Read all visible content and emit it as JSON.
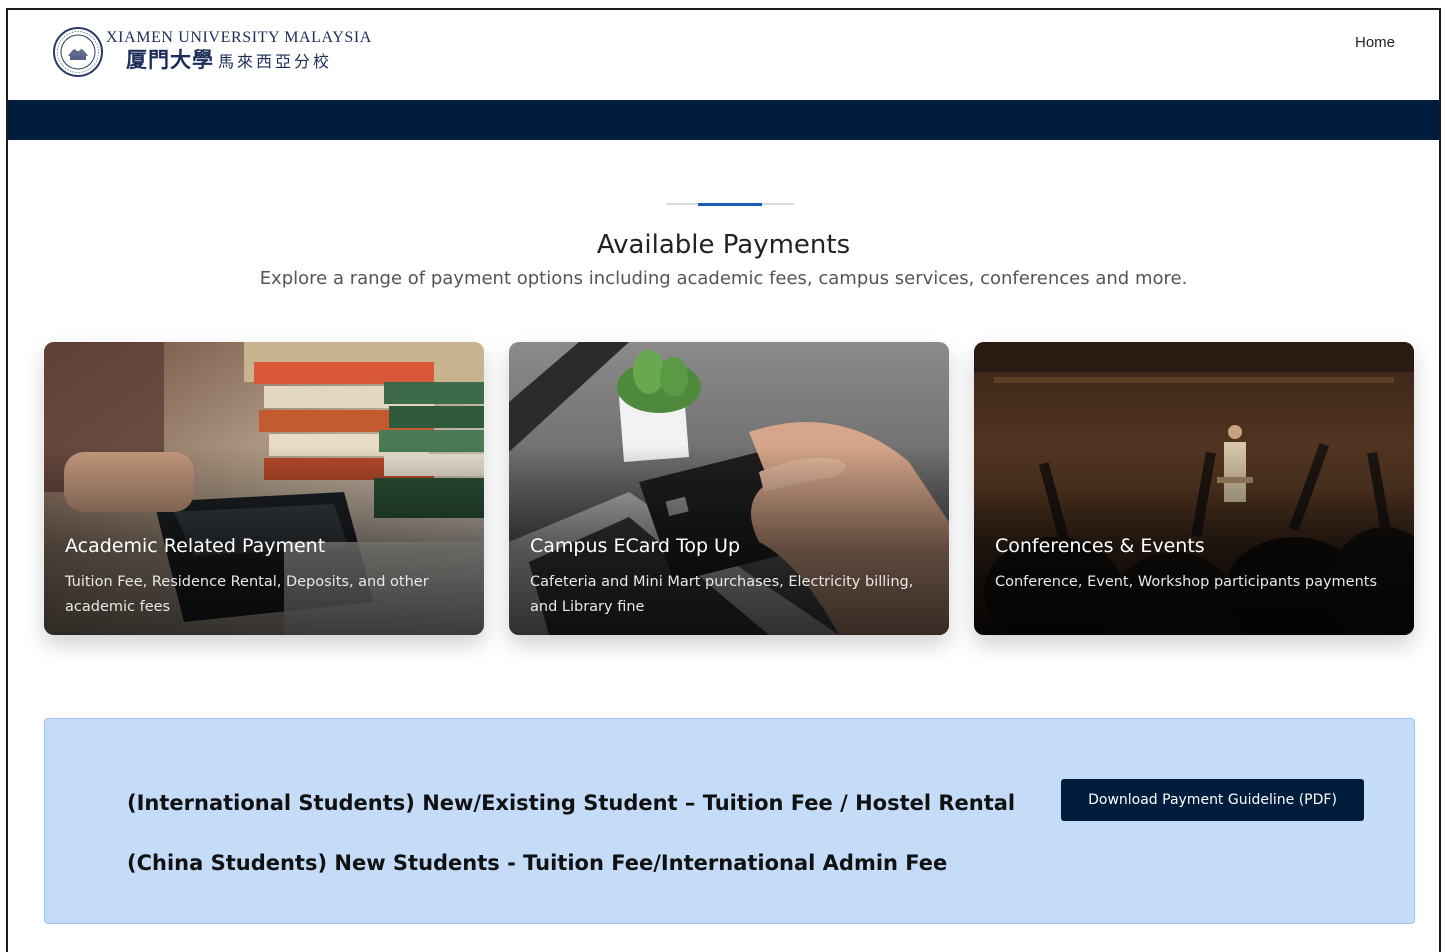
{
  "header": {
    "logo": {
      "name_en": "XIAMEN UNIVERSITY MALAYSIA",
      "name_cn_main": "厦門大學",
      "name_cn_sub": "馬來西亞分校"
    },
    "nav": {
      "home_label": "Home"
    }
  },
  "section": {
    "title": "Available Payments",
    "subtitle": "Explore a range of payment options including academic fees, campus services, conferences and more."
  },
  "cards": [
    {
      "title": "Academic Related Payment",
      "description": "Tuition Fee, Residence Rental, Deposits, and other academic fees"
    },
    {
      "title": "Campus ECard Top Up",
      "description": "Cafeteria and Mini Mart purchases, Electricity billing, and Library fine"
    },
    {
      "title": "Conferences & Events",
      "description": "Conference, Event, Workshop participants payments"
    }
  ],
  "info": {
    "line1": "(International Students) New/Existing Student – Tuition Fee / Hostel Rental",
    "line2": "(China Students) New Students - Tuition Fee/International Admin Fee",
    "download_label": "Download Payment Guideline (PDF)"
  },
  "colors": {
    "navy": "#001d3d",
    "accent_blue": "#1a5ab8",
    "info_bg": "#c4dcf7"
  }
}
